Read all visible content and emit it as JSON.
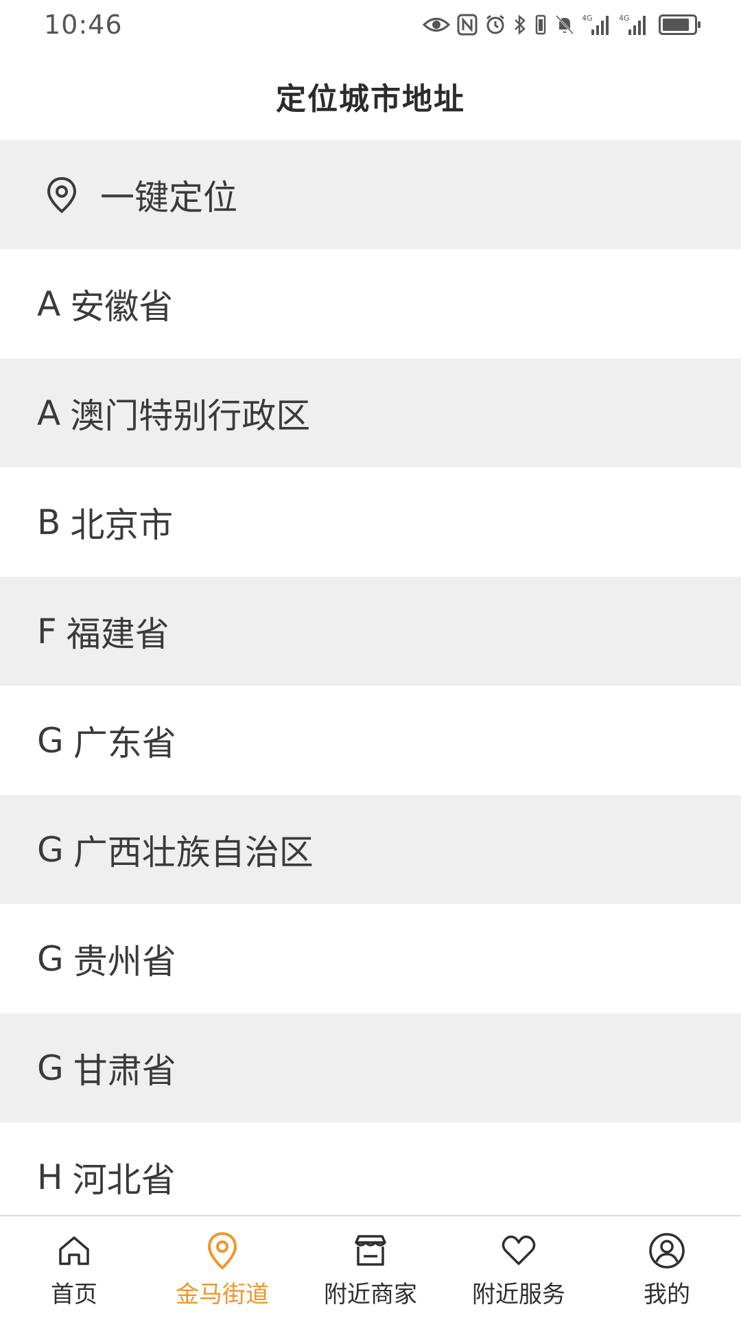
{
  "status_bar": {
    "time": "10:46",
    "icons": [
      "eye-icon",
      "nfc-icon",
      "alarm-icon",
      "bluetooth-icon",
      "vibrate-icon",
      "mute-bell-icon",
      "signal-4g-icon",
      "signal-4g-icon",
      "battery-icon"
    ],
    "signal_label_1": "4G",
    "signal_label_2": "4G"
  },
  "header": {
    "title": "定位城市地址"
  },
  "locate": {
    "label": "一键定位"
  },
  "provinces": [
    {
      "letter": "A",
      "name": "安徽省"
    },
    {
      "letter": "A",
      "name": "澳门特别行政区"
    },
    {
      "letter": "B",
      "name": "北京市"
    },
    {
      "letter": "F",
      "name": "福建省"
    },
    {
      "letter": "G",
      "name": "广东省"
    },
    {
      "letter": "G",
      "name": "广西壮族自治区"
    },
    {
      "letter": "G",
      "name": "贵州省"
    },
    {
      "letter": "G",
      "name": "甘肃省"
    },
    {
      "letter": "H",
      "name": "河北省"
    }
  ],
  "tabbar": {
    "accent_color": "#f0952b",
    "tabs": [
      {
        "label": "首页",
        "icon": "home-icon",
        "active": false
      },
      {
        "label": "金马街道",
        "icon": "location-pin-icon",
        "active": true
      },
      {
        "label": "附近商家",
        "icon": "store-icon",
        "active": false
      },
      {
        "label": "附近服务",
        "icon": "heart-icon",
        "active": false
      },
      {
        "label": "我的",
        "icon": "user-icon",
        "active": false
      }
    ]
  }
}
